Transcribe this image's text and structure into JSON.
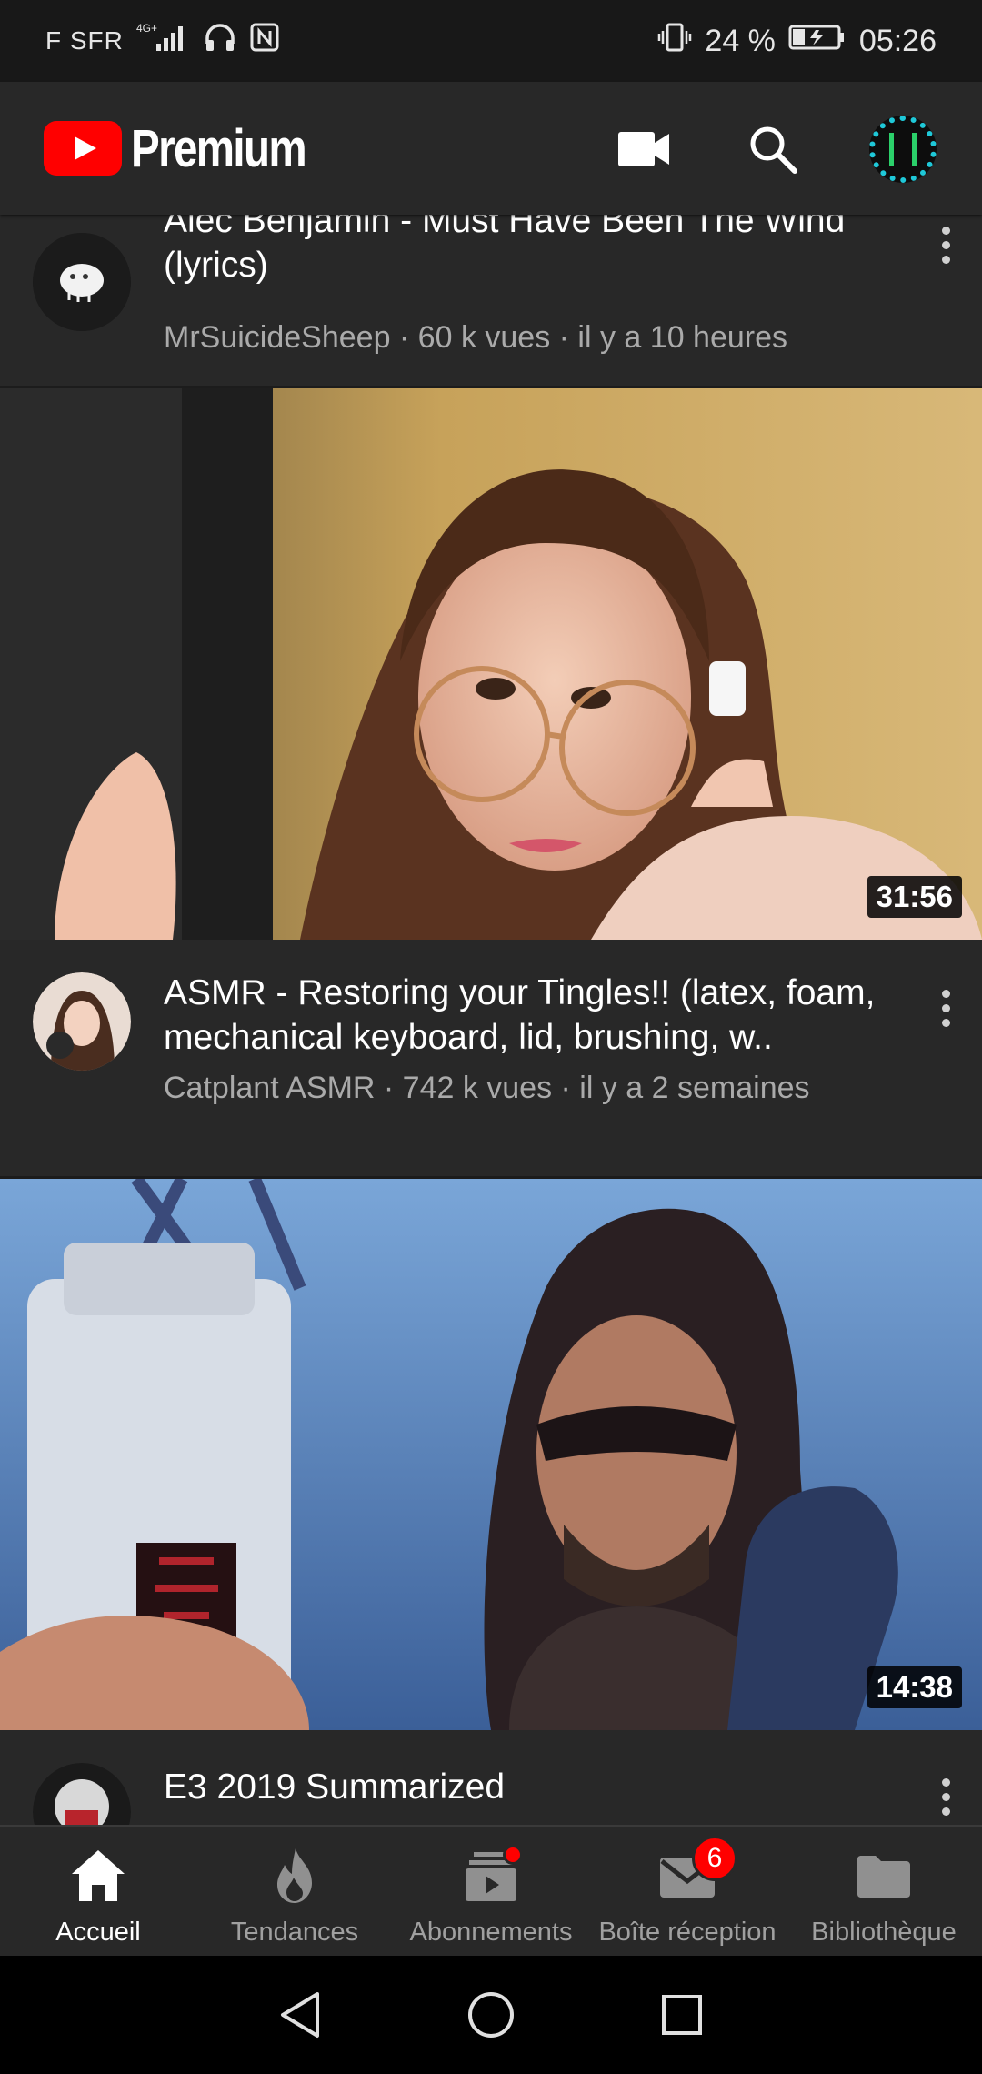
{
  "status_bar": {
    "carrier": "F SFR",
    "network": "4G+",
    "battery": "24 %",
    "time": "05:26"
  },
  "app_bar": {
    "logo_text": "Premium",
    "icons": [
      "video-camera-icon",
      "search-icon",
      "account-avatar"
    ]
  },
  "feed": {
    "videos": [
      {
        "title": "Alec Benjamin - Must Have Been The Wind (lyrics)",
        "channel": "MrSuicideSheep",
        "views": "60 k vues",
        "age": "il y a 10 heures",
        "subtitle": "MrSuicideSheep · 60 k vues · il y a 10 heures"
      },
      {
        "title": "ASMR - Restoring your Tingles!! (latex, foam, mechanical keyboard, lid, brushing, w..",
        "channel": "Catplant ASMR",
        "views": "742 k vues",
        "age": "il y a 2 semaines",
        "subtitle": "Catplant ASMR · 742 k vues · il y a 2 semaines",
        "duration": "31:56"
      },
      {
        "title": "E3 2019 Summarized",
        "duration": "14:38"
      }
    ]
  },
  "bottom_nav": {
    "items": [
      {
        "label": "Accueil",
        "icon": "home-icon",
        "active": true
      },
      {
        "label": "Tendances",
        "icon": "flame-icon"
      },
      {
        "label": "Abonnements",
        "icon": "subscriptions-icon",
        "badge_dot": true
      },
      {
        "label": "Boîte réception",
        "icon": "mail-icon",
        "badge": "6"
      },
      {
        "label": "Bibliothèque",
        "icon": "folder-icon"
      }
    ]
  },
  "colors": {
    "brand_red": "#ff0000",
    "background": "#282828",
    "secondary_text": "#aaaaaa",
    "avatar_ring": "#1fc8d8"
  }
}
